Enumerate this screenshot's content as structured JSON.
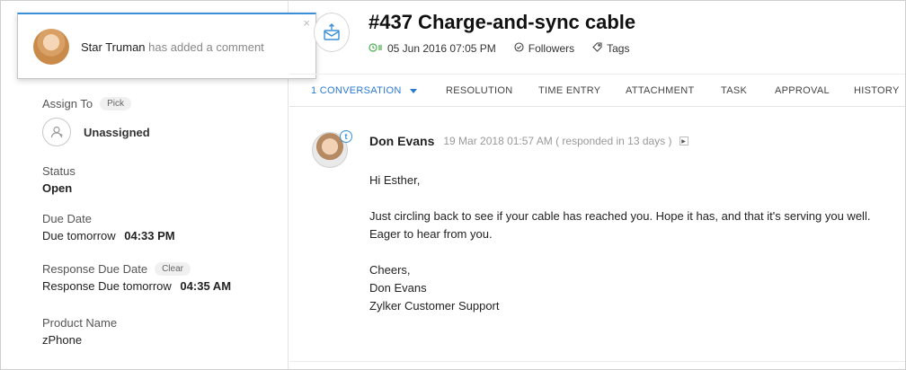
{
  "notification": {
    "user": "Star Truman",
    "action": "has added a comment",
    "close": "×"
  },
  "ticket": {
    "title": "#437  Charge-and-sync cable",
    "date": "05 Jun 2016 07:05 PM",
    "followers": "Followers",
    "tags": "Tags"
  },
  "fields": {
    "assign_to": {
      "label": "Assign To",
      "action": "Pick",
      "value": "Unassigned"
    },
    "status": {
      "label": "Status",
      "value": "Open"
    },
    "due_date": {
      "label": "Due Date",
      "prefix": "Due tomorrow",
      "time": "04:33 PM"
    },
    "response_due": {
      "label": "Response Due Date",
      "action": "Clear",
      "prefix": "Response Due tomorrow",
      "time": "04:35 AM"
    },
    "product": {
      "label": "Product Name",
      "value": "zPhone"
    }
  },
  "tabs": [
    {
      "label": "1 CONVERSATION",
      "active": true
    },
    {
      "label": "RESOLUTION"
    },
    {
      "label": "TIME ENTRY"
    },
    {
      "label": "ATTACHMENT"
    },
    {
      "label": "TASK"
    },
    {
      "label": "APPROVAL"
    },
    {
      "label": "HISTORY"
    }
  ],
  "message": {
    "author": "Don Evans",
    "time": "19 Mar 2018 01:57 AM ( responded in 13 days )",
    "badge": "t",
    "expand": "▶",
    "body": [
      "Hi Esther,",
      "Just circling back to see if your cable has reached you. Hope it has, and that it's serving you well.",
      "Eager to hear from you.",
      "Cheers,",
      "Don Evans",
      "Zylker Customer Support"
    ]
  },
  "colors": {
    "accent": "#2a7ad1",
    "notification_border": "#3a8fd8"
  },
  "icons": {
    "ticket": "envelope-arrow-icon",
    "date": "clock-status-icon",
    "followers": "check-circle-icon",
    "tags": "tag-icon",
    "assignee": "user-outline-icon",
    "dropdown": "caret-down-icon"
  }
}
